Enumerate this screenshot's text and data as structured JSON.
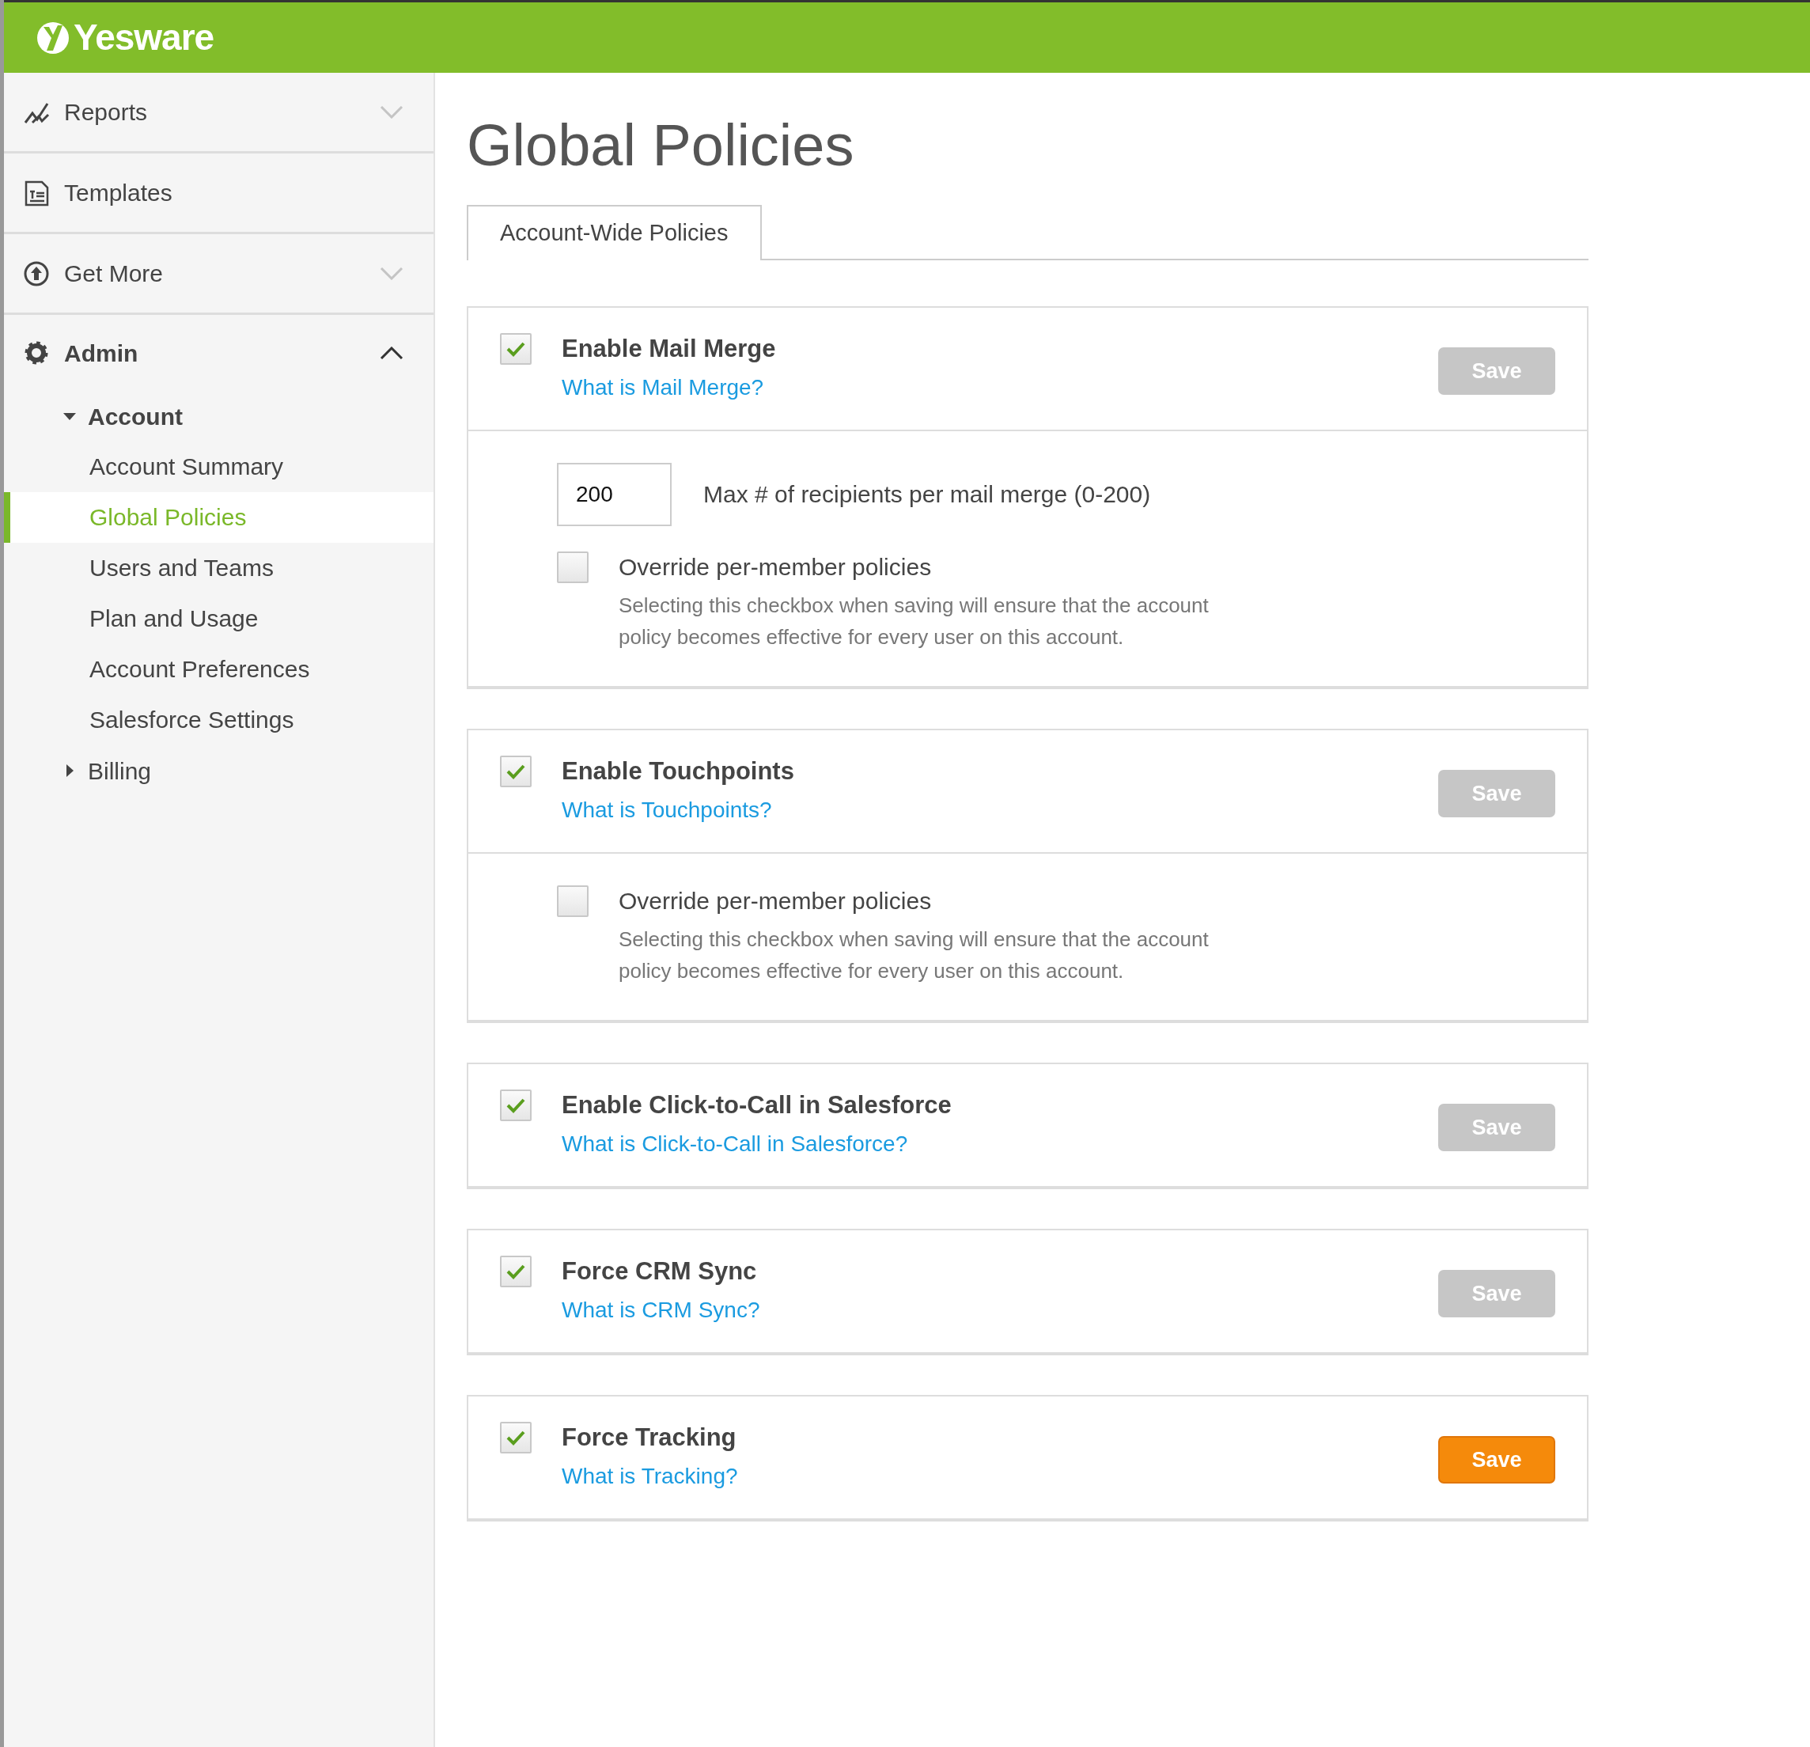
{
  "brand": {
    "name": "Yesware"
  },
  "sidebar": {
    "items": [
      {
        "label": "Reports",
        "kind": "dropdown",
        "expanded": false
      },
      {
        "label": "Templates",
        "kind": "link",
        "expanded": false
      },
      {
        "label": "Get More",
        "kind": "dropdown",
        "expanded": false
      },
      {
        "label": "Admin",
        "kind": "dropdown",
        "expanded": true,
        "children": [
          {
            "label": "Account",
            "expanded": true,
            "children": [
              {
                "label": "Account Summary",
                "selected": false
              },
              {
                "label": "Global Policies",
                "selected": true
              },
              {
                "label": "Users and Teams",
                "selected": false
              },
              {
                "label": "Plan and Usage",
                "selected": false
              },
              {
                "label": "Account Preferences",
                "selected": false
              },
              {
                "label": "Salesforce Settings",
                "selected": false
              }
            ]
          },
          {
            "label": "Billing",
            "expanded": false
          }
        ]
      }
    ]
  },
  "page_title": "Global Policies",
  "tabs": [
    {
      "label": "Account-Wide Policies",
      "selected": true
    }
  ],
  "policies": [
    {
      "title": "Enable Mail Merge",
      "checked": true,
      "link": "What is Mail Merge?",
      "save": {
        "label": "Save",
        "enabled": false
      },
      "options": [
        {
          "kind": "number",
          "value": "200",
          "label": "Max # of recipients per mail merge (0-200)"
        },
        {
          "kind": "checkbox",
          "checked": false,
          "label": "Override per-member policies",
          "description": "Selecting this checkbox when saving will ensure that the account policy becomes effective for every user on this account."
        }
      ]
    },
    {
      "title": "Enable Touchpoints",
      "checked": true,
      "link": "What is Touchpoints?",
      "save": {
        "label": "Save",
        "enabled": false
      },
      "options": [
        {
          "kind": "checkbox",
          "checked": false,
          "label": "Override per-member policies",
          "description": "Selecting this checkbox when saving will ensure that the account policy becomes effective for every user on this account."
        }
      ]
    },
    {
      "title": "Enable Click-to-Call in Salesforce",
      "checked": true,
      "link": "What is Click-to-Call in Salesforce?",
      "save": {
        "label": "Save",
        "enabled": false
      }
    },
    {
      "title": "Force CRM Sync",
      "checked": true,
      "link": "What is CRM Sync?",
      "save": {
        "label": "Save",
        "enabled": false
      }
    },
    {
      "title": "Force Tracking",
      "checked": true,
      "link": "What is Tracking?",
      "save": {
        "label": "Save",
        "enabled": true
      }
    }
  ]
}
